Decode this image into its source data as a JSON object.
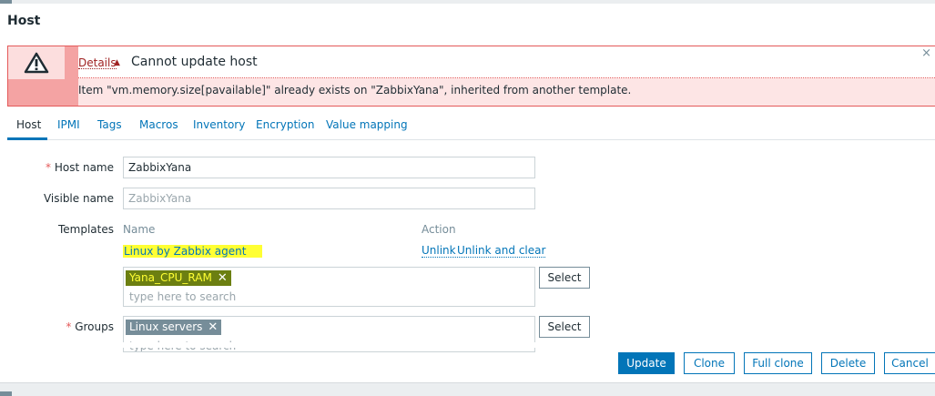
{
  "dialog": {
    "title": "Host"
  },
  "error": {
    "details_label": "Details",
    "details_arrow": "▲",
    "title": "Cannot update host",
    "detail": "Item \"vm.memory.size[pavailable]\" already exists on \"ZabbixYana\", inherited from another template.",
    "close_glyph": "×"
  },
  "tabs": [
    {
      "label": "Host",
      "active": true
    },
    {
      "label": "IPMI"
    },
    {
      "label": "Tags"
    },
    {
      "label": "Macros"
    },
    {
      "label": "Inventory"
    },
    {
      "label": "Encryption"
    },
    {
      "label": "Value mapping"
    }
  ],
  "form": {
    "required_mark": "*",
    "host_name": {
      "label": "Host name",
      "value": "ZabbixYana"
    },
    "visible_name": {
      "label": "Visible name",
      "placeholder": "ZabbixYana"
    },
    "templates": {
      "label": "Templates",
      "col_name": "Name",
      "col_action": "Action",
      "linked": [
        {
          "name": "Linux by Zabbix agent",
          "unlink": "Unlink",
          "unlink_clear": "Unlink and clear"
        }
      ],
      "new_chip": "Yana_CPU_RAM",
      "search_placeholder": "type here to search",
      "select_label": "Select"
    },
    "groups": {
      "label": "Groups",
      "chip": "Linux servers",
      "search_placeholder": "type here to search",
      "select_label": "Select"
    },
    "chip_remove_glyph": "✕"
  },
  "footer": {
    "update": "Update",
    "clone": "Clone",
    "full_clone": "Full clone",
    "delete": "Delete",
    "cancel": "Cancel"
  },
  "colors": {
    "error_border": "#e45959",
    "link": "#0275b8",
    "highlight": "#ffff33"
  }
}
